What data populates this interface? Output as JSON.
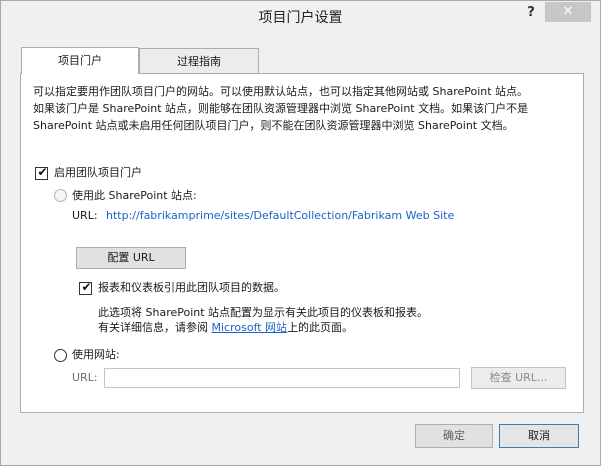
{
  "window": {
    "title": "项目门户设置",
    "help_label": "?",
    "close_label": "✕"
  },
  "tabs": [
    {
      "label": "项目门户",
      "active": true
    },
    {
      "label": "过程指南",
      "active": false
    }
  ],
  "description": [
    "可以指定要用作团队项目门户的网站。可以使用默认站点，也可以指定其他网站或 SharePoint 站点。",
    "如果该门户是 SharePoint 站点，则能够在团队资源管理器中浏览 SharePoint 文档。如果该门户不是",
    "SharePoint 站点或未启用任何团队项目门户，则不能在团队资源管理器中浏览 SharePoint 文档。"
  ],
  "enable_portal": {
    "label": "启用团队项目门户",
    "checked": true
  },
  "sharepoint_option": {
    "label": "使用此 SharePoint 站点:",
    "selected": false,
    "url_label": "URL:",
    "url_value": "http://fabrikamprime/sites/DefaultCollection/Fabrikam Web Site",
    "configure_button": "配置 URL"
  },
  "reports_checkbox": {
    "label": "报表和仪表板引用此团队项目的数据。",
    "checked": true,
    "note_line1": "此选项将 SharePoint 站点配置为显示有关此项目的仪表板和报表。",
    "note_line2_prefix": "有关详细信息，请参阅 ",
    "note_link": "Microsoft 网站",
    "note_line2_suffix": "上的此页面。"
  },
  "website_option": {
    "label": "使用网站:",
    "selected": true,
    "url_label": "URL:",
    "url_value": "",
    "check_button": "检查 URL..."
  },
  "footer": {
    "ok_label": "确定",
    "cancel_label": "取消"
  },
  "icons": {
    "check": "✔",
    "help": "question-mark",
    "close": "close-x"
  }
}
